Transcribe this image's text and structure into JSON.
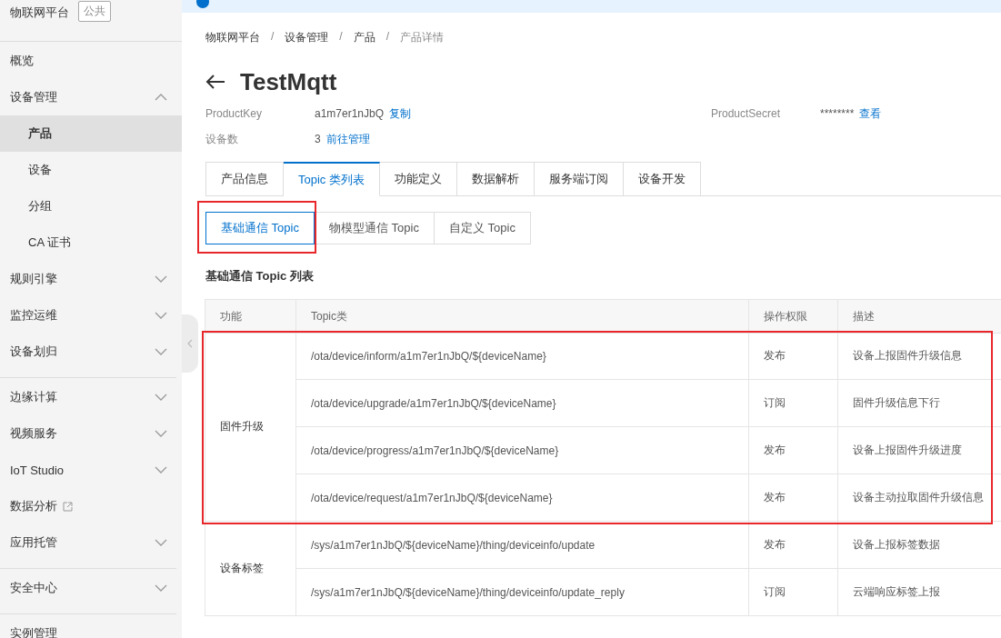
{
  "sidebar": {
    "title": "物联网平台",
    "badge": "公共",
    "sections": [
      [
        {
          "kind": "plain",
          "label": "概览"
        },
        {
          "kind": "menu",
          "label": "设备管理",
          "expanded": true,
          "children": [
            {
              "label": "产品",
              "selected": true
            },
            {
              "label": "设备",
              "selected": false
            },
            {
              "label": "分组",
              "selected": false
            },
            {
              "label": "CA 证书",
              "selected": false
            }
          ]
        },
        {
          "kind": "menu",
          "label": "规则引擎",
          "expanded": false
        },
        {
          "kind": "menu",
          "label": "监控运维",
          "expanded": false
        },
        {
          "kind": "menu",
          "label": "设备划归",
          "expanded": false
        }
      ],
      [
        {
          "kind": "menu",
          "label": "边缘计算",
          "expanded": false
        },
        {
          "kind": "menu",
          "label": "视频服务",
          "expanded": false
        },
        {
          "kind": "menu",
          "label": "IoT Studio",
          "expanded": false
        },
        {
          "kind": "external",
          "label": "数据分析"
        },
        {
          "kind": "menu",
          "label": "应用托管",
          "expanded": false
        }
      ],
      [
        {
          "kind": "menu",
          "label": "安全中心",
          "expanded": false
        }
      ],
      [
        {
          "kind": "plain",
          "label": "实例管理"
        }
      ]
    ]
  },
  "breadcrumb": [
    "物联网平台",
    "设备管理",
    "产品",
    "产品详情"
  ],
  "breadcrumb_separator": "/",
  "title": "TestMqtt",
  "info": [
    {
      "label": "ProductKey",
      "value": "a1m7er1nJbQ",
      "link": "复制"
    },
    {
      "label": "ProductSecret",
      "value": "********",
      "link": "查看"
    },
    {
      "label": "设备数",
      "value": "3",
      "link": "前往管理"
    }
  ],
  "tabs": [
    {
      "label": "产品信息",
      "selected": false
    },
    {
      "label": "Topic 类列表",
      "selected": true
    },
    {
      "label": "功能定义",
      "selected": false
    },
    {
      "label": "数据解析",
      "selected": false
    },
    {
      "label": "服务端订阅",
      "selected": false
    },
    {
      "label": "设备开发",
      "selected": false
    }
  ],
  "sub_tabs": [
    {
      "label": "基础通信 Topic",
      "selected": true,
      "highlighted": true
    },
    {
      "label": "物模型通信 Topic",
      "selected": false,
      "highlighted": false
    },
    {
      "label": "自定义 Topic",
      "selected": false,
      "highlighted": false
    }
  ],
  "section_title": "基础通信 Topic 列表",
  "table": {
    "columns": [
      "功能",
      "Topic类",
      "操作权限",
      "描述"
    ],
    "groups": [
      {
        "function": "固件升级",
        "highlighted": true,
        "rows": [
          {
            "topic": "/ota/device/inform/a1m7er1nJbQ/${deviceName}",
            "permission": "发布",
            "description": "设备上报固件升级信息"
          },
          {
            "topic": "/ota/device/upgrade/a1m7er1nJbQ/${deviceName}",
            "permission": "订阅",
            "description": "固件升级信息下行"
          },
          {
            "topic": "/ota/device/progress/a1m7er1nJbQ/${deviceName}",
            "permission": "发布",
            "description": "设备上报固件升级进度"
          },
          {
            "topic": "/ota/device/request/a1m7er1nJbQ/${deviceName}",
            "permission": "发布",
            "description": "设备主动拉取固件升级信息"
          }
        ]
      },
      {
        "function": "设备标签",
        "highlighted": false,
        "rows": [
          {
            "topic": "/sys/a1m7er1nJbQ/${deviceName}/thing/deviceinfo/update",
            "permission": "发布",
            "description": "设备上报标签数据"
          },
          {
            "topic": "/sys/a1m7er1nJbQ/${deviceName}/thing/deviceinfo/update_reply",
            "permission": "订阅",
            "description": "云端响应标签上报"
          }
        ]
      }
    ]
  }
}
